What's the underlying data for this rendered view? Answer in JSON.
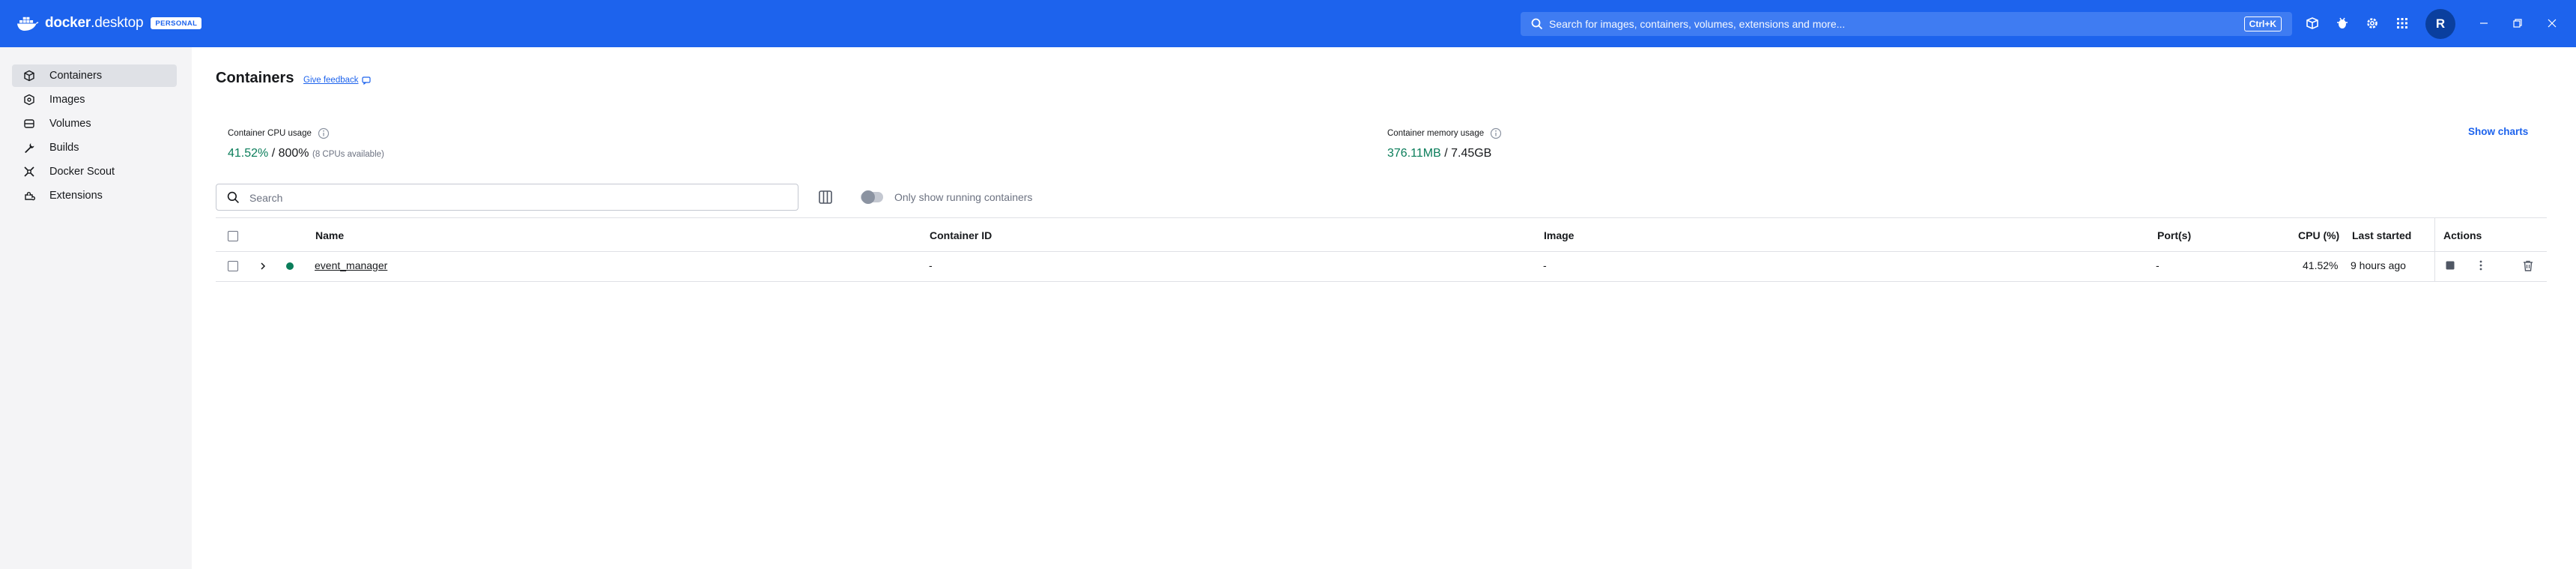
{
  "titlebar": {
    "logo_docker": "docker",
    "logo_desktop": "desktop",
    "plan_badge": "PERSONAL",
    "search_placeholder": "Search for images, containers, volumes, extensions and more...",
    "search_shortcut": "Ctrl+K",
    "avatar_initial": "R",
    "icons": [
      "learning-center-icon",
      "extensions-bug-icon",
      "settings-gear-icon",
      "apps-grid-icon"
    ],
    "window_controls": [
      "minimize-icon",
      "restore-icon",
      "close-icon"
    ],
    "accent_color": "#1d63ed"
  },
  "sidebar": {
    "items": [
      {
        "label": "Containers",
        "icon": "containers-icon",
        "active": true
      },
      {
        "label": "Images",
        "icon": "images-icon",
        "active": false
      },
      {
        "label": "Volumes",
        "icon": "volumes-icon",
        "active": false
      },
      {
        "label": "Builds",
        "icon": "builds-wrench-icon",
        "active": false
      },
      {
        "label": "Docker Scout",
        "icon": "scout-icon",
        "active": false
      },
      {
        "label": "Extensions",
        "icon": "extensions-icon",
        "active": false
      }
    ]
  },
  "main": {
    "title": "Containers",
    "feedback_link": "Give feedback",
    "cpu": {
      "label": "Container CPU usage",
      "value": "41.52%",
      "separator": " / ",
      "total": "800%",
      "sub": "(8 CPUs available)"
    },
    "memory": {
      "label": "Container memory usage",
      "value": "376.11MB",
      "separator": " / ",
      "total": "7.45GB"
    },
    "show_charts": "Show charts",
    "search_placeholder": "Search",
    "toggle_label": "Only show running containers",
    "toggle_on": false,
    "table": {
      "columns": [
        "Name",
        "Container ID",
        "Image",
        "Port(s)",
        "CPU (%)",
        "Last started",
        "Actions"
      ],
      "rows": [
        {
          "name": "event_manager",
          "container_id": "-",
          "image": "-",
          "ports": "-",
          "cpu": "41.52%",
          "last_started": "9 hours ago",
          "status": "running",
          "status_color": "#0a7d5a"
        }
      ]
    }
  }
}
